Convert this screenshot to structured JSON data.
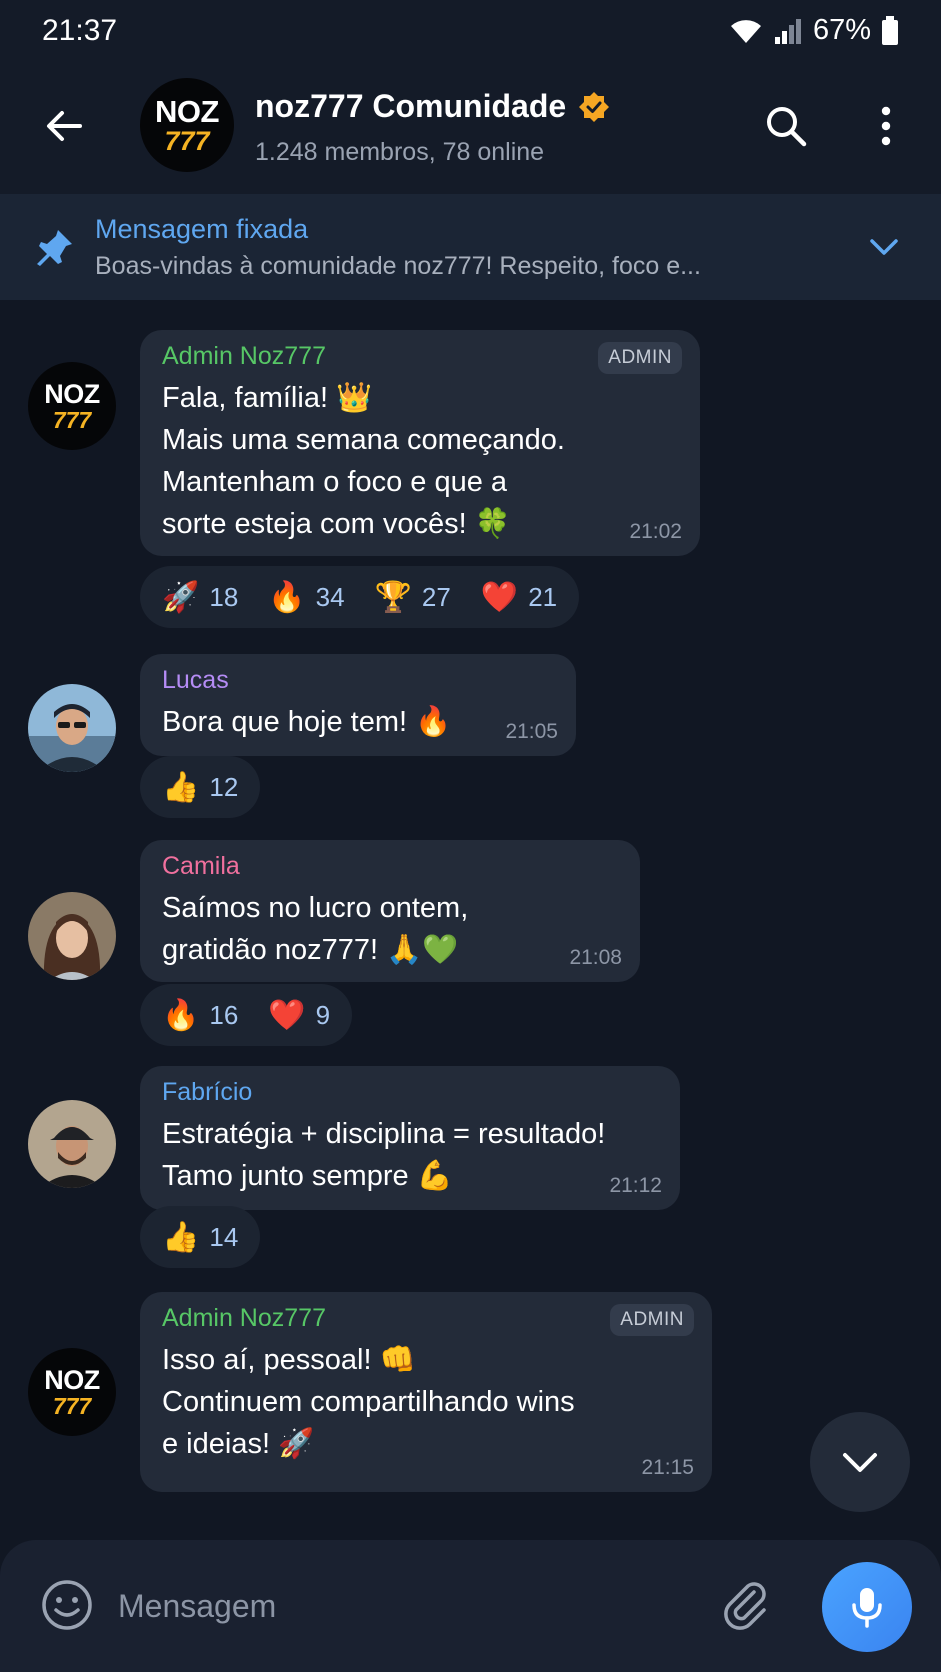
{
  "status_bar": {
    "time": "21:37",
    "battery": "67%"
  },
  "header": {
    "logo_top": "NOZ",
    "logo_bottom": "777",
    "title": "noz777 Comunidade",
    "subtitle": "1.248 membros, 78 online"
  },
  "pinned": {
    "title": "Mensagem fixada",
    "text": "Boas-vindas à comunidade noz777! Respeito, foco e..."
  },
  "colors": {
    "accent": "#5fa7f0",
    "admin_name": "#57c766",
    "lucas_name": "#b58cf5",
    "camila_name": "#f0709e",
    "fabricio_name": "#5fa7f0",
    "verified": "#f5a623"
  },
  "messages": [
    {
      "sender": "Admin Noz777",
      "badge": "ADMIN",
      "text": "Fala, família! 👑\nMais uma semana começando.\nMantenham o foco e que a\nsorte esteja com vocês! 🍀",
      "time": "21:02",
      "reactions": [
        {
          "emoji": "🚀",
          "count": "18"
        },
        {
          "emoji": "🔥",
          "count": "34"
        },
        {
          "emoji": "🏆",
          "count": "27"
        },
        {
          "emoji": "❤️",
          "count": "21"
        }
      ]
    },
    {
      "sender": "Lucas",
      "text": "Bora que hoje tem! 🔥",
      "time": "21:05",
      "reactions": [
        {
          "emoji": "👍",
          "count": "12"
        }
      ]
    },
    {
      "sender": "Camila",
      "text": "Saímos no lucro ontem,\ngratidão noz777! 🙏💚",
      "time": "21:08",
      "reactions": [
        {
          "emoji": "🔥",
          "count": "16"
        },
        {
          "emoji": "❤️",
          "count": "9"
        }
      ]
    },
    {
      "sender": "Fabrício",
      "text": "Estratégia + disciplina = resultado!\nTamo junto sempre 💪",
      "time": "21:12",
      "reactions": [
        {
          "emoji": "👍",
          "count": "14"
        }
      ]
    },
    {
      "sender": "Admin Noz777",
      "badge": "ADMIN",
      "text": "Isso aí, pessoal! 👊\nContinuem compartilhando wins\ne ideias! 🚀",
      "time": "21:15"
    }
  ],
  "composer": {
    "placeholder": "Mensagem"
  }
}
